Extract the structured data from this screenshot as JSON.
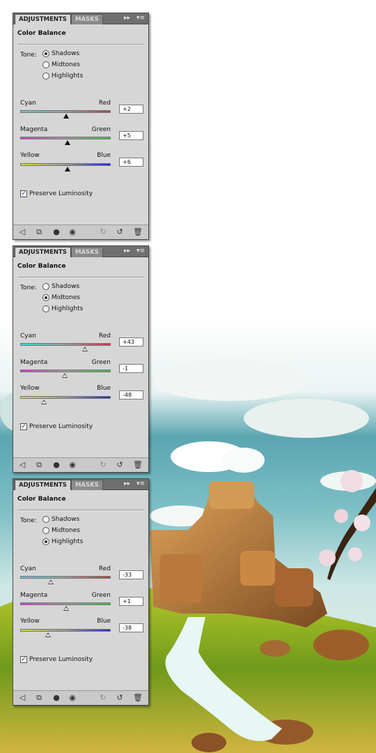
{
  "panels": [
    {
      "tabs": {
        "active": "ADJUSTMENTS",
        "inactive": "MASKS"
      },
      "title": "Color Balance",
      "tone_label": "Tone:",
      "tones": [
        "Shadows",
        "Midtones",
        "Highlights"
      ],
      "selected_tone": "Shadows",
      "sliders": [
        {
          "left": "Cyan",
          "right": "Red",
          "value": "+2",
          "level": 0.505
        },
        {
          "left": "Magenta",
          "right": "Green",
          "value": "+5",
          "level": 0.52
        },
        {
          "left": "Yellow",
          "right": "Blue",
          "value": "+6",
          "level": 0.525
        }
      ],
      "preserve_luminosity": "Preserve Luminosity",
      "preserve_checked": true
    },
    {
      "tabs": {
        "active": "ADJUSTMENTS",
        "inactive": "MASKS"
      },
      "title": "Color Balance",
      "tone_label": "Tone:",
      "tones": [
        "Shadows",
        "Midtones",
        "Highlights"
      ],
      "selected_tone": "Midtones",
      "sliders": [
        {
          "left": "Cyan",
          "right": "Red",
          "value": "+43",
          "level": 0.715
        },
        {
          "left": "Magenta",
          "right": "Green",
          "value": "-1",
          "level": 0.495
        },
        {
          "left": "Yellow",
          "right": "Blue",
          "value": "-48",
          "level": 0.26
        }
      ],
      "preserve_luminosity": "Preserve Luminosity",
      "preserve_checked": true
    },
    {
      "tabs": {
        "active": "ADJUSTMENTS",
        "inactive": "MASKS"
      },
      "title": "Color Balance",
      "tone_label": "Tone:",
      "tones": [
        "Shadows",
        "Midtones",
        "Highlights"
      ],
      "selected_tone": "Highlights",
      "sliders": [
        {
          "left": "Cyan",
          "right": "Red",
          "value": "-33",
          "level": 0.335
        },
        {
          "left": "Magenta",
          "right": "Green",
          "value": "+1",
          "level": 0.505
        },
        {
          "left": "Yellow",
          "right": "Blue",
          "value": "-38",
          "level": 0.31
        }
      ],
      "preserve_luminosity": "Preserve Luminosity",
      "preserve_checked": true
    }
  ],
  "tab_buttons": {
    "collapse": "▸▸",
    "menu": "▾≡"
  },
  "bottom_icons": [
    "back-arrow-icon",
    "clip-layer-icon",
    "visibility-circle-icon",
    "eye-icon",
    "previous-state-icon",
    "reset-icon",
    "trash-icon"
  ],
  "colors": {
    "panel_bg": "#d6d6d6",
    "cyan_red": [
      "#3fd6d6",
      "#c8383f"
    ],
    "magenta_green": [
      "#d23dd0",
      "#3fbe4a"
    ],
    "yellow_blue": [
      "#d6d43c",
      "#1f2ec0"
    ]
  }
}
